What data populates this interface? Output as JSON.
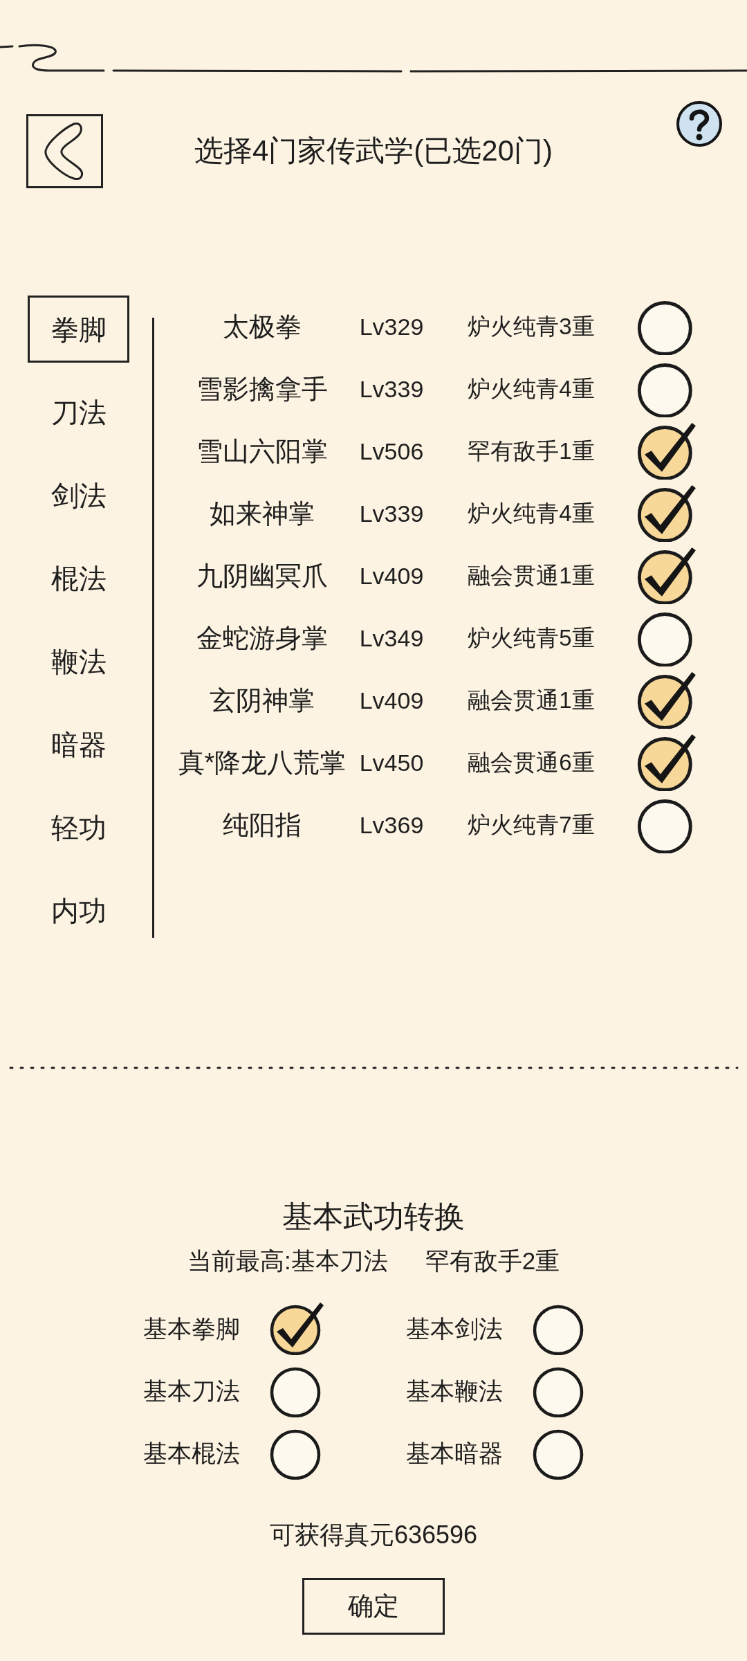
{
  "header": {
    "title": "选择4门家传武学(已选20门)"
  },
  "categories": [
    {
      "label": "拳脚",
      "selected": true
    },
    {
      "label": "刀法",
      "selected": false
    },
    {
      "label": "剑法",
      "selected": false
    },
    {
      "label": "棍法",
      "selected": false
    },
    {
      "label": "鞭法",
      "selected": false
    },
    {
      "label": "暗器",
      "selected": false
    },
    {
      "label": "轻功",
      "selected": false
    },
    {
      "label": "内功",
      "selected": false
    }
  ],
  "skills": [
    {
      "name": "太极拳",
      "level_text": "Lv329",
      "realm": "炉火纯青3重",
      "checked": false
    },
    {
      "name": "雪影擒拿手",
      "level_text": "Lv339",
      "realm": "炉火纯青4重",
      "checked": false
    },
    {
      "name": "雪山六阳掌",
      "level_text": "Lv506",
      "realm": "罕有敌手1重",
      "checked": true
    },
    {
      "name": "如来神掌",
      "level_text": "Lv339",
      "realm": "炉火纯青4重",
      "checked": true
    },
    {
      "name": "九阴幽冥爪",
      "level_text": "Lv409",
      "realm": "融会贯通1重",
      "checked": true
    },
    {
      "name": "金蛇游身掌",
      "level_text": "Lv349",
      "realm": "炉火纯青5重",
      "checked": false
    },
    {
      "name": "玄阴神掌",
      "level_text": "Lv409",
      "realm": "融会贯通1重",
      "checked": true
    },
    {
      "name": "真*降龙八荒掌",
      "level_text": "Lv450",
      "realm": "融会贯通6重",
      "checked": true
    },
    {
      "name": "纯阳指",
      "level_text": "Lv369",
      "realm": "炉火纯青7重",
      "checked": false
    }
  ],
  "conversion": {
    "title": "基本武功转换",
    "current_best": "当前最高:基本刀法",
    "current_realm": "罕有敌手2重",
    "options": [
      {
        "label": "基本拳脚",
        "checked": true
      },
      {
        "label": "基本剑法",
        "checked": false
      },
      {
        "label": "基本刀法",
        "checked": false
      },
      {
        "label": "基本鞭法",
        "checked": false
      },
      {
        "label": "基本棍法",
        "checked": false
      },
      {
        "label": "基本暗器",
        "checked": false
      }
    ],
    "reward": "可获得真元636596"
  },
  "confirm_button": {
    "label": "确定"
  }
}
